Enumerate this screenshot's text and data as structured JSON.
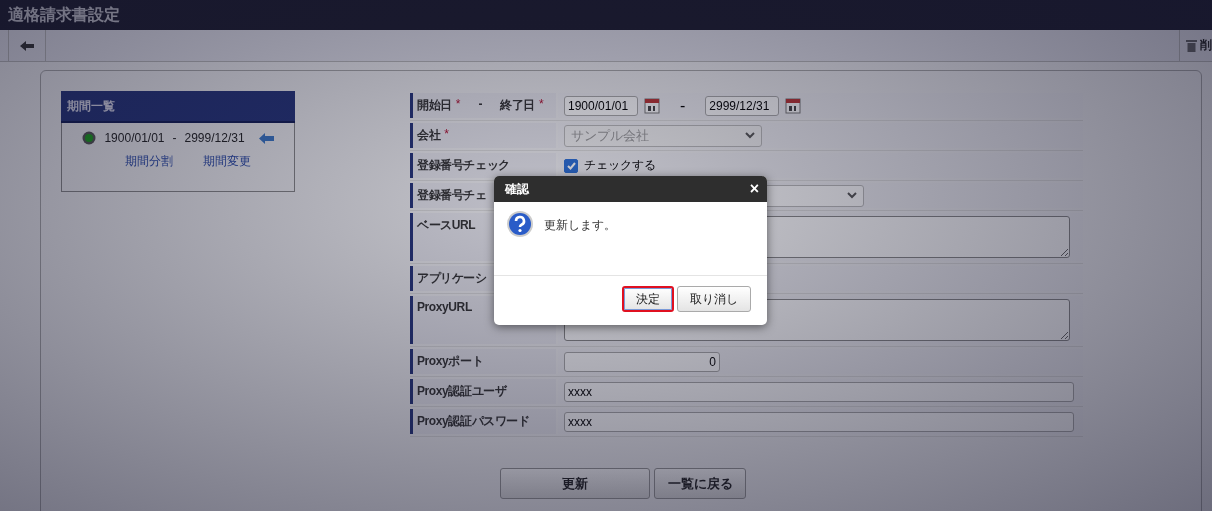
{
  "window": {
    "title": "適格請求書設定"
  },
  "toolbar": {
    "delete_label": "削"
  },
  "period_list": {
    "title": "期間一覧",
    "items": [
      {
        "start": "1900/01/01",
        "separator": "-",
        "end": "2999/12/31"
      }
    ],
    "links": [
      "期間分割",
      "期間変更"
    ]
  },
  "form": {
    "rows": [
      {
        "kind": "date_range",
        "label": "開始日",
        "required_mark": "*",
        "separator": "-",
        "label2": "終了日",
        "required_mark2": "*",
        "start": "1900/01/01",
        "end": "2999/12/31"
      },
      {
        "kind": "select",
        "label": "会社",
        "required_mark": "*",
        "value": "サンプル会社",
        "disabled": true
      },
      {
        "kind": "checkbox",
        "label": "登録番号チェック",
        "checked": true,
        "text": "チェックする"
      },
      {
        "kind": "select",
        "label": "登録番号チェ",
        "value": "",
        "disabled": false
      },
      {
        "kind": "textarea",
        "label": "ベースURL",
        "value": ""
      },
      {
        "kind": "blank",
        "label": "アプリケーシ"
      },
      {
        "kind": "textarea",
        "label": "ProxyURL",
        "value": ""
      },
      {
        "kind": "number",
        "label": "Proxyポート",
        "value": "0"
      },
      {
        "kind": "text",
        "label": "Proxy認証ユーザ",
        "value": "xxxx"
      },
      {
        "kind": "text",
        "label": "Proxy認証パスワード",
        "value": "xxxx"
      }
    ],
    "buttons": [
      "更新",
      "一覧に戻る"
    ]
  },
  "dialog": {
    "title": "確認",
    "close": "×",
    "message": "更新します。",
    "buttons": [
      {
        "label": "決定",
        "highlighted": true
      },
      {
        "label": "取り消し",
        "highlighted": false
      }
    ]
  }
}
